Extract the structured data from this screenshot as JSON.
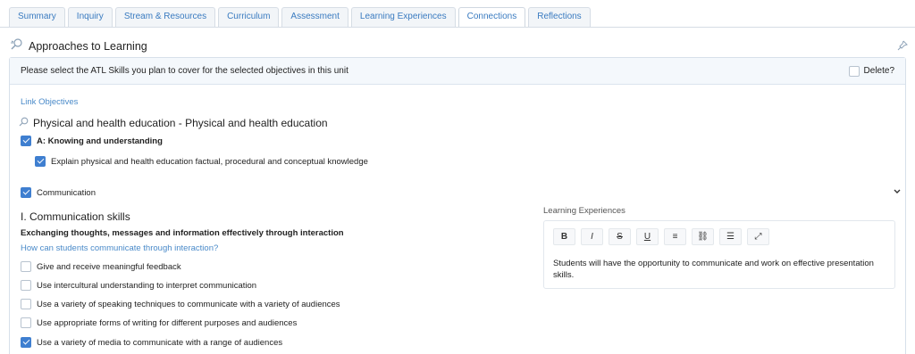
{
  "tabs": [
    "Summary",
    "Inquiry",
    "Stream & Resources",
    "Curriculum",
    "Assessment",
    "Learning Experiences",
    "Connections",
    "Reflections"
  ],
  "active_tab": "Connections",
  "section": {
    "title": "Approaches to Learning",
    "icon": "lightbulb-icon",
    "pin_icon": "pin-icon"
  },
  "panel": {
    "instruction": "Please select the ATL Skills you plan to cover for the selected objectives in this unit",
    "delete_label": "Delete?",
    "link_objectives": "Link Objectives",
    "subject": "Physical and health education - Physical and health education",
    "objective": "A: Knowing and understanding",
    "objective_item": "Explain physical and health education factual, procedural and conceptual knowledge",
    "category": "Communication",
    "skill_title": "I. Communication skills",
    "skill_subtitle": "Exchanging thoughts, messages and information effectively through interaction",
    "skill_question": "How can students communicate through interaction?",
    "skills": [
      {
        "label": "Give and receive meaningful feedback",
        "checked": false
      },
      {
        "label": "Use intercultural understanding to interpret communication",
        "checked": false
      },
      {
        "label": "Use a variety of speaking techniques to communicate with a variety of audiences",
        "checked": false
      },
      {
        "label": "Use appropriate forms of writing for different purposes and audiences",
        "checked": false
      },
      {
        "label": "Use a variety of media to communicate with a range of audiences",
        "checked": true
      }
    ]
  },
  "editor": {
    "label": "Learning Experiences",
    "toolbar": [
      "B",
      "I",
      "S",
      "U",
      "≡",
      "⛓",
      "☰",
      "⤢"
    ],
    "text": "Students will have the opportunity to communicate and work on effective presentation skills."
  },
  "colors": {
    "accent": "#3f7fd0",
    "link": "#4a8ac9",
    "header_bg": "#f4f8fc"
  }
}
